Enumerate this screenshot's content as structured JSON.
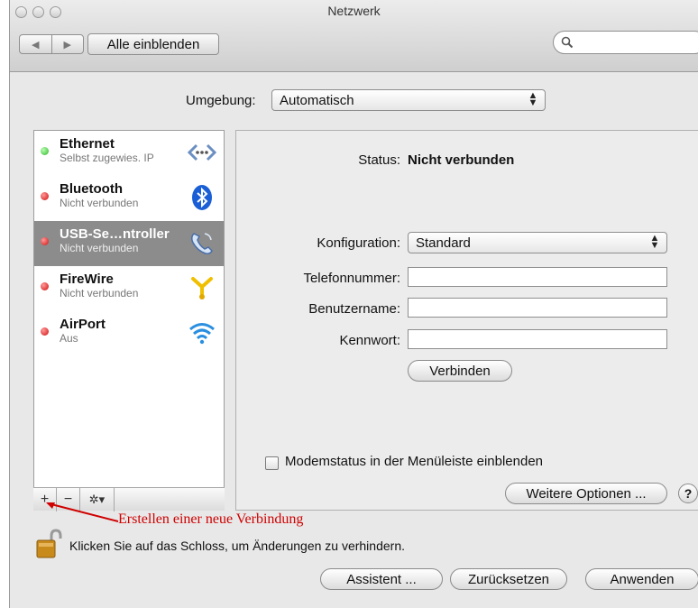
{
  "window": {
    "title": "Netzwerk"
  },
  "toolbar": {
    "back_icon": "back-arrow-icon",
    "forward_icon": "forward-arrow-icon",
    "show_all_label": "Alle einblenden",
    "search_placeholder": ""
  },
  "environment": {
    "label": "Umgebung:",
    "value": "Automatisch"
  },
  "services": [
    {
      "name": "Ethernet",
      "status": "Selbst zugewies. IP",
      "dot_color": "#2fb52a",
      "icon": "ethernet-icon",
      "selected": false
    },
    {
      "name": "Bluetooth",
      "status": "Nicht verbunden",
      "dot_color": "#d00d0d",
      "icon": "bluetooth-icon",
      "selected": false
    },
    {
      "name": "USB-Se…ntroller",
      "status": "Nicht verbunden",
      "dot_color": "#d00d0d",
      "icon": "telephone-icon",
      "selected": true
    },
    {
      "name": "FireWire",
      "status": "Nicht verbunden",
      "dot_color": "#d00d0d",
      "icon": "firewire-icon",
      "selected": false
    },
    {
      "name": "AirPort",
      "status": "Aus",
      "dot_color": "#d00d0d",
      "icon": "wifi-icon",
      "selected": false
    }
  ],
  "list_tools": {
    "add_label": "+",
    "remove_label": "−",
    "action_label": "✲▾"
  },
  "detail": {
    "status_label": "Status:",
    "status_value": "Nicht verbunden",
    "config_label": "Konfiguration:",
    "config_value": "Standard",
    "phone_label": "Telefonnummer:",
    "phone_value": "",
    "user_label": "Benutzername:",
    "user_value": "",
    "password_label": "Kennwort:",
    "password_value": "",
    "connect_button": "Verbinden",
    "modem_checkbox_label": "Modemstatus in der Menüleiste einblenden",
    "modem_checked": false,
    "more_options_button": "Weitere Optionen ...",
    "help_label": "?"
  },
  "annotation": {
    "text": "Erstellen einer neue Verbindung",
    "color": "#d00000"
  },
  "footer": {
    "lock_text": "Klicken Sie auf das Schloss, um Änderungen zu verhindern.",
    "assistant_button": "Assistent ...",
    "revert_button": "Zurücksetzen",
    "apply_button": "Anwenden"
  }
}
